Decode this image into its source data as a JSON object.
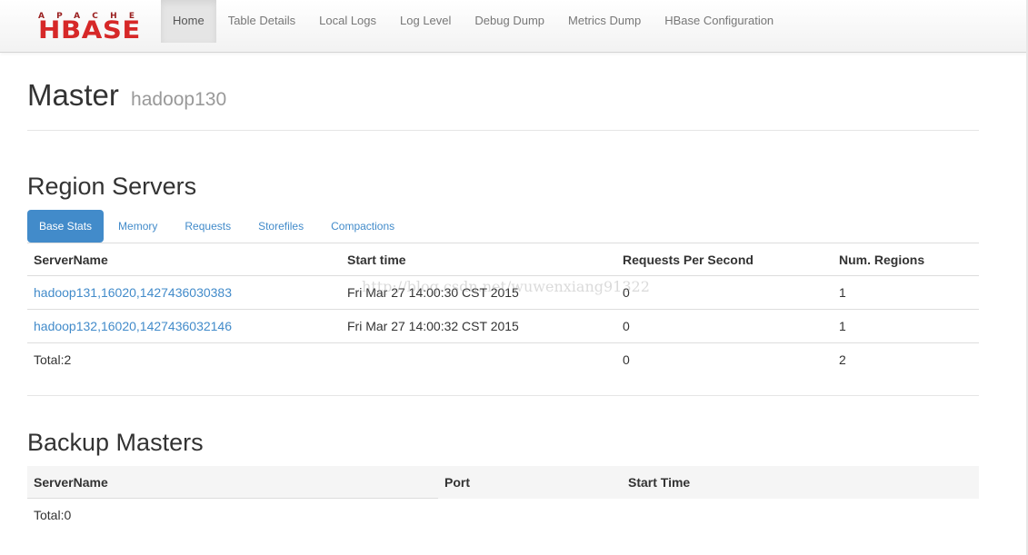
{
  "logo": {
    "apache": "APACHE",
    "hbase": "HBASE"
  },
  "nav": {
    "items": [
      {
        "label": "Home",
        "active": true
      },
      {
        "label": "Table Details"
      },
      {
        "label": "Local Logs"
      },
      {
        "label": "Log Level"
      },
      {
        "label": "Debug Dump"
      },
      {
        "label": "Metrics Dump"
      },
      {
        "label": "HBase Configuration"
      }
    ]
  },
  "header": {
    "title": "Master",
    "host": "hadoop130"
  },
  "region_servers": {
    "title": "Region Servers",
    "tabs": [
      {
        "label": "Base Stats",
        "active": true
      },
      {
        "label": "Memory"
      },
      {
        "label": "Requests"
      },
      {
        "label": "Storefiles"
      },
      {
        "label": "Compactions"
      }
    ],
    "columns": [
      "ServerName",
      "Start time",
      "Requests Per Second",
      "Num. Regions"
    ],
    "rows": [
      {
        "server": "hadoop131,16020,1427436030383",
        "start": "Fri Mar 27 14:00:30 CST 2015",
        "rps": "0",
        "regions": "1"
      },
      {
        "server": "hadoop132,16020,1427436032146",
        "start": "Fri Mar 27 14:00:32 CST 2015",
        "rps": "0",
        "regions": "1"
      }
    ],
    "total": {
      "label": "Total:2",
      "rps": "0",
      "regions": "2"
    }
  },
  "backup_masters": {
    "title": "Backup Masters",
    "columns": [
      "ServerName",
      "Port",
      "Start Time"
    ],
    "total": "Total:0"
  },
  "watermark": "http://blog.csdn.net/wuwenxiang91322",
  "colors": {
    "link": "#428bca",
    "active_tab_bg": "#428bca",
    "logo_red": "#d62828"
  }
}
